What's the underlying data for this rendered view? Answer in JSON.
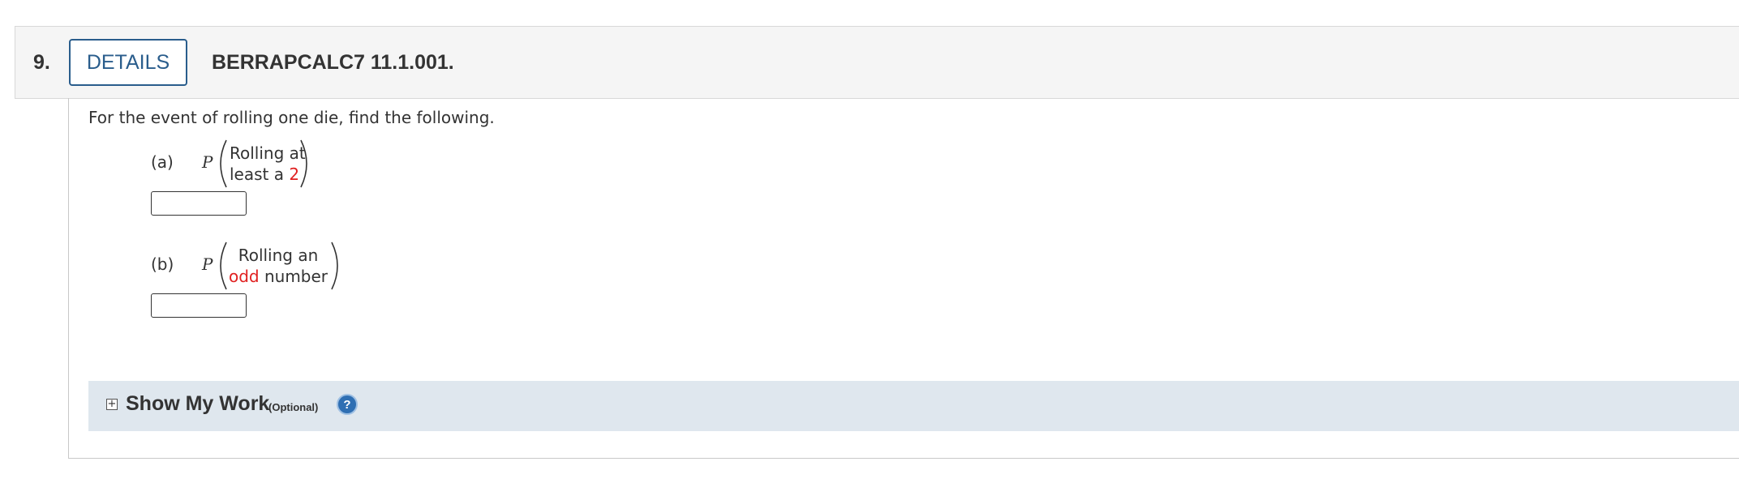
{
  "question": {
    "number": "9.",
    "details_label": "DETAILS",
    "code": "BERRAPCALC7 11.1.001."
  },
  "prompt": "For the event of rolling one die, find the following.",
  "parts": [
    {
      "label": "(a)",
      "p": "P",
      "line1": "Rolling at",
      "line2_pre": "least a ",
      "line2_red": "2",
      "line2_post": "",
      "answer_value": ""
    },
    {
      "label": "(b)",
      "p": "P",
      "line1": "Rolling an",
      "line2_pre": "",
      "line2_red": "odd",
      "line2_post": " number",
      "answer_value": ""
    }
  ],
  "show_my_work": {
    "expand_icon": "plus-box-icon",
    "expand_glyph": "+",
    "title": "Show My Work",
    "optional": "(Optional)",
    "help_icon": "question-circle-icon",
    "help_glyph": "?"
  },
  "colors": {
    "accent": "#2a5d8c",
    "highlight_red": "#e02020",
    "smw_background": "#dfe7ee",
    "header_background": "#f5f5f5"
  }
}
